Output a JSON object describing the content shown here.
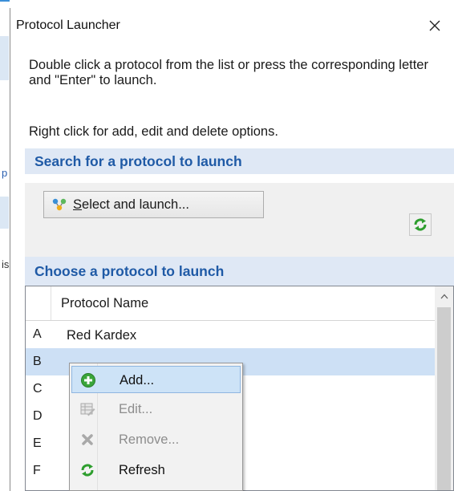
{
  "background": {
    "fragment_chars": [
      "p",
      "is"
    ]
  },
  "dialog": {
    "title": "Protocol Launcher",
    "close_icon": "close-icon",
    "instructions": "Double click a protocol from the list or press the corresponding letter and \"Enter\" to launch.",
    "hint": "Right click for add, edit and delete options."
  },
  "search_section": {
    "header": "Search for a protocol to launch",
    "select_button": {
      "label_underlined": "S",
      "label_rest": "elect and launch...",
      "icon": "molecule-icon"
    },
    "refresh_icon": "refresh-icon"
  },
  "choose_section": {
    "header": "Choose a protocol to launch",
    "column_header": "Protocol Name",
    "rows": [
      {
        "letter": "A",
        "name": "Red Kardex",
        "selected": false
      },
      {
        "letter": "B",
        "name": "",
        "selected": true
      },
      {
        "letter": "C",
        "name": "",
        "selected": false
      },
      {
        "letter": "D",
        "name": "",
        "selected": false
      },
      {
        "letter": "E",
        "name": "",
        "selected": false
      },
      {
        "letter": "F",
        "name": "",
        "selected": false
      }
    ]
  },
  "context_menu": {
    "items": [
      {
        "label": "Add...",
        "icon": "add-icon",
        "enabled": true,
        "hover": true
      },
      {
        "label": "Edit...",
        "icon": "edit-icon",
        "enabled": false,
        "hover": false
      },
      {
        "label": "Remove...",
        "icon": "remove-icon",
        "enabled": false,
        "hover": false
      },
      {
        "label": "Refresh",
        "icon": "refresh-icon",
        "enabled": true,
        "hover": false
      }
    ]
  },
  "colors": {
    "section_header_bg": "#dfe8f5",
    "section_header_text": "#1f5aa6",
    "selected_row": "#cde0f5",
    "menu_hover": "#cde3f7"
  }
}
